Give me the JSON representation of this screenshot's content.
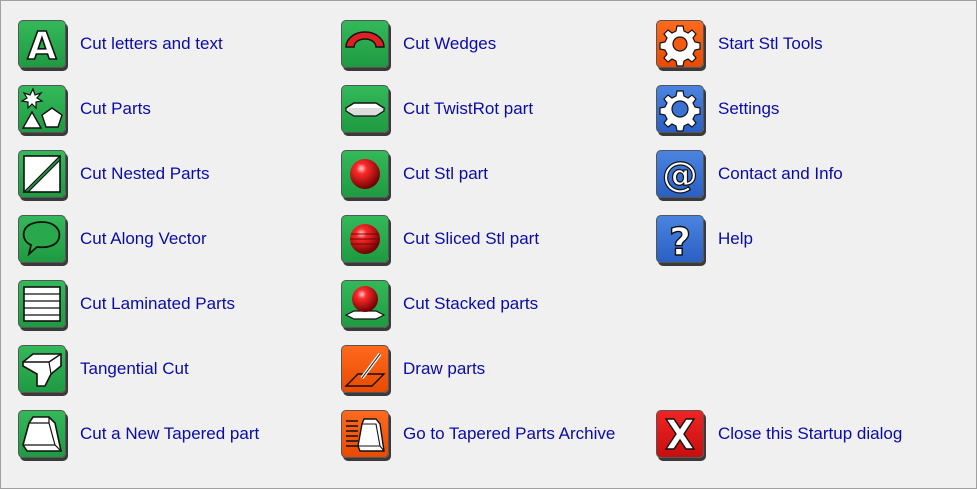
{
  "colors": {
    "label": "#0a0aa8",
    "green_icon": "#27ab4d",
    "orange_icon": "#f45a10",
    "blue_icon": "#3a72d4",
    "red_icon": "#e01818",
    "background": "#f0f0f0"
  },
  "items": {
    "cut_letters": {
      "label": "Cut letters and text",
      "icon": "letter-a-icon"
    },
    "cut_parts": {
      "label": "Cut Parts",
      "icon": "shapes-icon"
    },
    "cut_nested": {
      "label": "Cut Nested Parts",
      "icon": "nested-parts-icon"
    },
    "cut_vector": {
      "label": "Cut Along Vector",
      "icon": "vector-outline-icon"
    },
    "cut_laminated": {
      "label": "Cut Laminated Parts",
      "icon": "laminated-layers-icon"
    },
    "tangential": {
      "label": "Tangential Cut",
      "icon": "tangential-block-icon"
    },
    "cut_tapered": {
      "label": "Cut a New Tapered part",
      "icon": "tapered-block-icon"
    },
    "cut_wedges": {
      "label": "Cut Wedges",
      "icon": "wedge-arc-icon"
    },
    "cut_twistrot": {
      "label": "Cut TwistRot part",
      "icon": "twistrot-plate-icon"
    },
    "cut_stl": {
      "label": "Cut Stl part",
      "icon": "red-sphere-icon"
    },
    "cut_sliced_stl": {
      "label": "Cut Sliced Stl part",
      "icon": "sliced-sphere-icon"
    },
    "cut_stacked": {
      "label": "Cut Stacked parts",
      "icon": "stacked-sphere-icon"
    },
    "draw_parts": {
      "label": "Draw parts",
      "icon": "pen-draw-icon"
    },
    "tapered_archive": {
      "label": "Go to Tapered Parts Archive",
      "icon": "archive-tapered-icon"
    },
    "stl_tools": {
      "label": "Start Stl Tools",
      "icon": "gear-icon"
    },
    "settings": {
      "label": "Settings",
      "icon": "settings-gear-icon"
    },
    "contact": {
      "label": "Contact and Info",
      "icon": "at-sign-icon"
    },
    "help": {
      "label": "Help",
      "icon": "question-mark-icon"
    },
    "close": {
      "label": "Close this Startup dialog",
      "icon": "close-x-icon"
    }
  }
}
